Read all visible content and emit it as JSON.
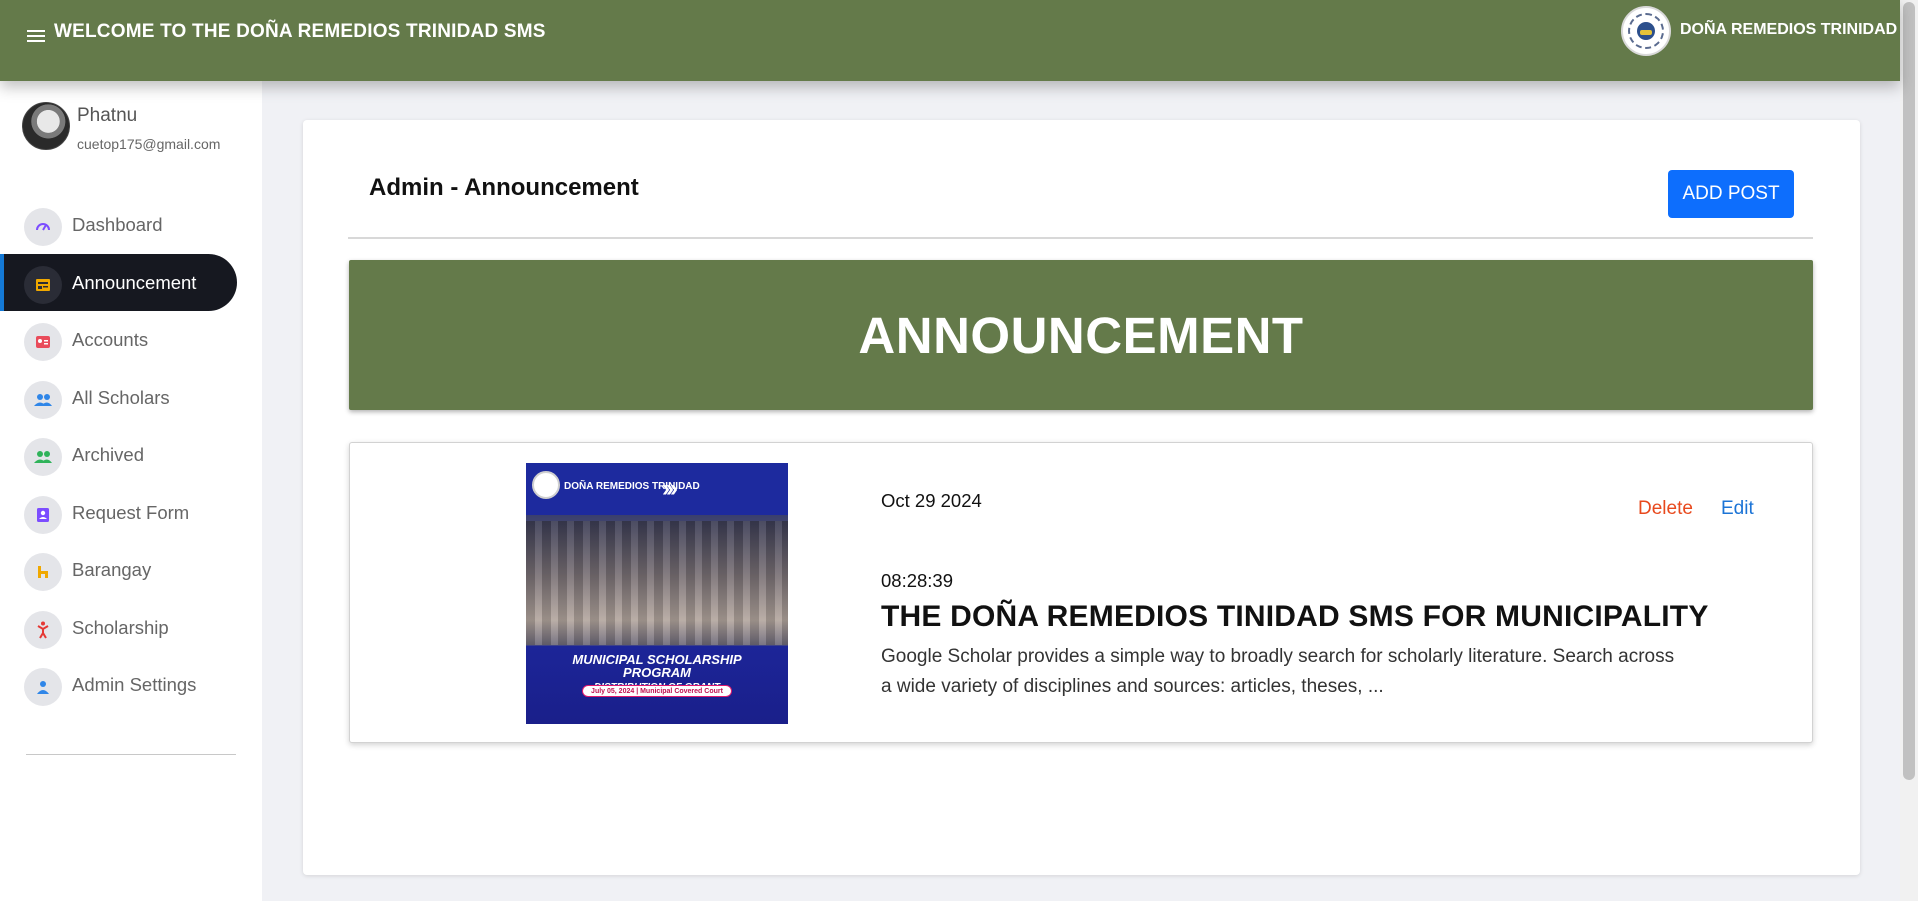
{
  "header": {
    "title": "WELCOME TO THE DOÑA REMEDIOS TRINIDAD SMS",
    "brand_name": "DOÑA REMEDIOS TRINIDAD",
    "accent_color": "#647a4a"
  },
  "profile": {
    "name": "Phatnu",
    "email": "cuetop175@gmail.com"
  },
  "sidebar": {
    "items": [
      {
        "label": "Dashboard",
        "icon": "speedometer-icon",
        "icon_color": "#7c4dff",
        "active": false
      },
      {
        "label": "Announcement",
        "icon": "newspaper-icon",
        "icon_color": "#f0a800",
        "active": true
      },
      {
        "label": "Accounts",
        "icon": "id-card-icon",
        "icon_color": "#e94c5b",
        "active": false
      },
      {
        "label": "All Scholars",
        "icon": "people-icon",
        "icon_color": "#2f86e8",
        "active": false
      },
      {
        "label": "Archived",
        "icon": "people-icon",
        "icon_color": "#2fb35a",
        "active": false
      },
      {
        "label": "Request Form",
        "icon": "contact-book-icon",
        "icon_color": "#7c4dff",
        "active": false
      },
      {
        "label": "Barangay",
        "icon": "hotel-icon",
        "icon_color": "#f0a800",
        "active": false
      },
      {
        "label": "Scholarship",
        "icon": "figure-icon",
        "icon_color": "#e53935",
        "active": false
      },
      {
        "label": "Admin Settings",
        "icon": "person-icon",
        "icon_color": "#2f86e8",
        "active": false
      }
    ]
  },
  "main": {
    "page_title": "Admin - Announcement",
    "add_button_label": "ADD POST",
    "banner_title": "ANNOUNCEMENT",
    "posts": [
      {
        "date": "Oct 29 2024",
        "time": "08:28:39",
        "title": "THE DOÑA REMEDIOS TINIDAD SMS FOR MUNICIPALITY",
        "body": "Google Scholar provides a simple way to broadly search for scholarly literature. Search across a wide variety of disciplines and sources: articles, theses, ...",
        "delete_label": "Delete",
        "edit_label": "Edit",
        "image": {
          "header_text": "DOÑA REMEDIOS TRINIDAD",
          "program_text": "MUNICIPAL SCHOLARSHIP PROGRAM",
          "subtitle_text": "DISTRIBUTION OF GRANT",
          "pill_text": "July 05, 2024 | Municipal Covered Court"
        }
      }
    ]
  }
}
